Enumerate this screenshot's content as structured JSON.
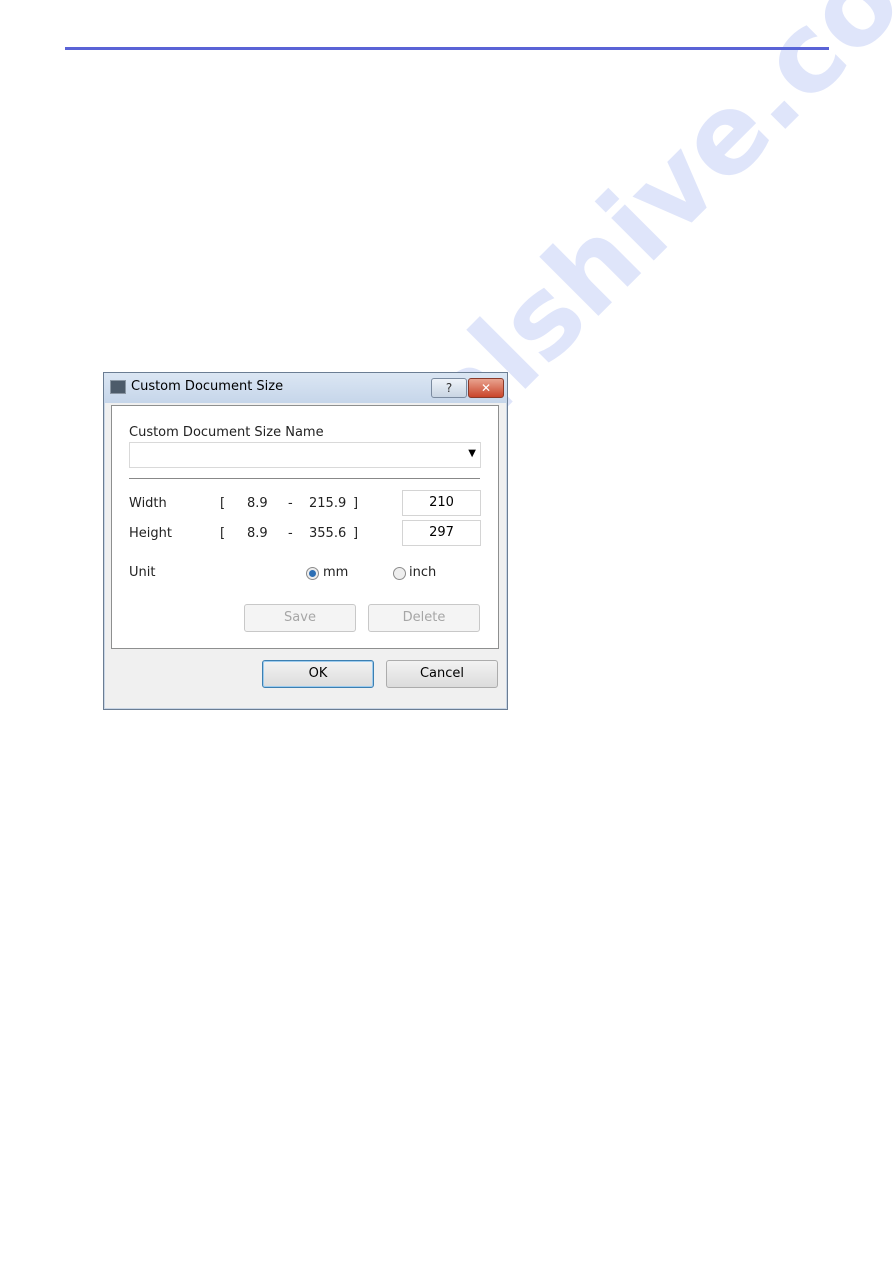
{
  "dialog": {
    "title": "Custom Document Size",
    "help_label": "?",
    "close_label": "✕",
    "name_label": "Custom Document Size Name",
    "name_value": "",
    "width": {
      "label": "Width",
      "open": "[",
      "min": "8.9",
      "dash": "-",
      "max": "215.9",
      "close": "]",
      "value": "210"
    },
    "height": {
      "label": "Height",
      "open": "[",
      "min": "8.9",
      "dash": "-",
      "max": "355.6",
      "close": "]",
      "value": "297"
    },
    "unit": {
      "label": "Unit",
      "options": [
        {
          "label": "mm",
          "selected": true
        },
        {
          "label": "inch",
          "selected": false
        }
      ]
    },
    "save_label": "Save",
    "delete_label": "Delete",
    "ok_label": "OK",
    "cancel_label": "Cancel"
  },
  "watermark": "manualshive.com",
  "colors": {
    "rule": "#5a63d6",
    "radio_selected": "#2d6fb5"
  }
}
